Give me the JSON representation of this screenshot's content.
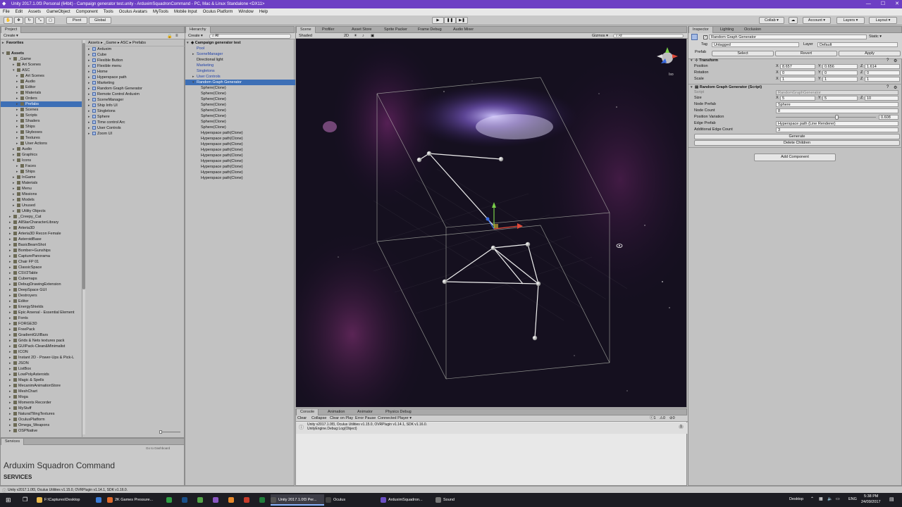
{
  "window": {
    "title": "Unity 2017.1.0f3 Personal (64bit) - Campaign generator test.unity - ArduximSquadronCommand - PC, Mac & Linux Standalone <DX11>"
  },
  "menu": [
    "File",
    "Edit",
    "Assets",
    "GameObject",
    "Component",
    "Tools",
    "Oculus Avatars",
    "MyTools",
    "Mobile Input",
    "Oculus Platform",
    "Window",
    "Help"
  ],
  "toolbar": {
    "pivot": "Pivot",
    "global": "Global",
    "collab": "Collab ▾",
    "account": "Account ▾",
    "layers": "Layers ▾",
    "layout": "Layout ▾"
  },
  "project": {
    "tab": "Project",
    "create": "Create ▾",
    "favorites": "Favorites",
    "assets_root": "Assets",
    "breadcrumb": "Assets ▸ _Game ▸ ASC ▸ Prefabs",
    "tree": [
      {
        "label": "_Game",
        "indent": 2,
        "open": true
      },
      {
        "label": "Art Scenes",
        "indent": 3
      },
      {
        "label": "ASC",
        "indent": 3,
        "open": true
      },
      {
        "label": "Art Scenes",
        "indent": 4
      },
      {
        "label": "Audio",
        "indent": 4
      },
      {
        "label": "Editor",
        "indent": 4
      },
      {
        "label": "Materials",
        "indent": 4
      },
      {
        "label": "Orders",
        "indent": 4
      },
      {
        "label": "Prefabs",
        "indent": 4,
        "selected": true
      },
      {
        "label": "Scenes",
        "indent": 4
      },
      {
        "label": "Scripts",
        "indent": 4
      },
      {
        "label": "Shaders",
        "indent": 4
      },
      {
        "label": "Ships",
        "indent": 4
      },
      {
        "label": "Skyboxes",
        "indent": 4
      },
      {
        "label": "Textures",
        "indent": 4
      },
      {
        "label": "User Actions",
        "indent": 4
      },
      {
        "label": "Audio",
        "indent": 3
      },
      {
        "label": "Graphics",
        "indent": 3
      },
      {
        "label": "Icons",
        "indent": 3,
        "open": true
      },
      {
        "label": "Faces",
        "indent": 4
      },
      {
        "label": "Ships",
        "indent": 4
      },
      {
        "label": "InGame",
        "indent": 3
      },
      {
        "label": "Materials",
        "indent": 3
      },
      {
        "label": "Menu",
        "indent": 3
      },
      {
        "label": "Missions",
        "indent": 3
      },
      {
        "label": "Models",
        "indent": 3
      },
      {
        "label": "Unused",
        "indent": 3
      },
      {
        "label": "Utility Objects",
        "indent": 3
      },
      {
        "label": "_Creepy_Cat",
        "indent": 2
      },
      {
        "label": "AllStarCharacterLibrary",
        "indent": 2
      },
      {
        "label": "Arteria3D",
        "indent": 2
      },
      {
        "label": "Arteria3D Recon Female",
        "indent": 2
      },
      {
        "label": "AsteroidBase",
        "indent": 2
      },
      {
        "label": "BasicBeamShot",
        "indent": 2
      },
      {
        "label": "Bomber+Gunships",
        "indent": 2
      },
      {
        "label": "CapturePanorama",
        "indent": 2
      },
      {
        "label": "Chair FP 01",
        "indent": 2
      },
      {
        "label": "ClassicSpace",
        "indent": 2
      },
      {
        "label": "CSV2Table",
        "indent": 2
      },
      {
        "label": "Cubemaps",
        "indent": 2
      },
      {
        "label": "DebugDrawingExtension",
        "indent": 2
      },
      {
        "label": "DeepSpace GUI",
        "indent": 2
      },
      {
        "label": "Destroyers",
        "indent": 2
      },
      {
        "label": "Editor",
        "indent": 2
      },
      {
        "label": "EnergyShields",
        "indent": 2
      },
      {
        "label": "Epic Arsenal - Essential Element",
        "indent": 2
      },
      {
        "label": "Fonts",
        "indent": 2
      },
      {
        "label": "FORGE3D",
        "indent": 2
      },
      {
        "label": "FreePack",
        "indent": 2
      },
      {
        "label": "GradientGUIBars",
        "indent": 2
      },
      {
        "label": "Grids & Nets textures pack",
        "indent": 2
      },
      {
        "label": "GUIPack-Clean&Minimalist",
        "indent": 2
      },
      {
        "label": "ICON",
        "indent": 2
      },
      {
        "label": "Instant 2D - Power-Ups & Pick-L",
        "indent": 2
      },
      {
        "label": "JSON",
        "indent": 2
      },
      {
        "label": "ListBox",
        "indent": 2
      },
      {
        "label": "LowPolyAsteroids",
        "indent": 2
      },
      {
        "label": "Magic & Spells",
        "indent": 2
      },
      {
        "label": "MecanimAnimationStore",
        "indent": 2
      },
      {
        "label": "MeshChart",
        "indent": 2
      },
      {
        "label": "Moga",
        "indent": 2
      },
      {
        "label": "Moments Recorder",
        "indent": 2
      },
      {
        "label": "MyStuff",
        "indent": 2
      },
      {
        "label": "NaturalTilingTextures",
        "indent": 2
      },
      {
        "label": "OculusPlatform",
        "indent": 2
      },
      {
        "label": "Omega_Weapons",
        "indent": 2
      },
      {
        "label": "OSPNative",
        "indent": 2
      }
    ],
    "files": [
      "Arduxim",
      "Cube",
      "Flexible Button",
      "Flexible menu",
      "Home",
      "Hyperspace path",
      "Marketing",
      "Random Graph Generator",
      "Remote Control Arduxim",
      "SceneManager",
      "Ship Info UI",
      "Singletons",
      "Sphere",
      "Time control Arc",
      "User Controls",
      "Zoom UI"
    ],
    "services_tab": "Services",
    "go_dashboard": "Go to Dashboard",
    "services_title": "Arduxim Squadron Command",
    "services_heading": "SERVICES"
  },
  "hierarchy": {
    "tab": "Hierarchy",
    "create": "Create ▾",
    "search": "All",
    "scene": "Campaign generator test",
    "items": [
      {
        "label": "Pool",
        "blue": true
      },
      {
        "label": "SceneManager",
        "blue": true,
        "arrow": true
      },
      {
        "label": "Directional light"
      },
      {
        "label": "Marketing",
        "blue": true
      },
      {
        "label": "Singletons",
        "blue": true
      },
      {
        "label": "User Controls",
        "blue": true,
        "arrow": true
      },
      {
        "label": "Random Graph Generator",
        "selected": true,
        "arrow": true
      },
      {
        "label": "Sphere(Clone)",
        "child": true
      },
      {
        "label": "Sphere(Clone)",
        "child": true
      },
      {
        "label": "Sphere(Clone)",
        "child": true
      },
      {
        "label": "Sphere(Clone)",
        "child": true
      },
      {
        "label": "Sphere(Clone)",
        "child": true
      },
      {
        "label": "Sphere(Clone)",
        "child": true
      },
      {
        "label": "Sphere(Clone)",
        "child": true
      },
      {
        "label": "Sphere(Clone)",
        "child": true
      },
      {
        "label": "Hyperspace path(Clone)",
        "child": true
      },
      {
        "label": "Hyperspace path(Clone)",
        "child": true
      },
      {
        "label": "Hyperspace path(Clone)",
        "child": true
      },
      {
        "label": "Hyperspace path(Clone)",
        "child": true
      },
      {
        "label": "Hyperspace path(Clone)",
        "child": true
      },
      {
        "label": "Hyperspace path(Clone)",
        "child": true
      },
      {
        "label": "Hyperspace path(Clone)",
        "child": true
      },
      {
        "label": "Hyperspace path(Clone)",
        "child": true
      },
      {
        "label": "Hyperspace path(Clone)",
        "child": true
      }
    ]
  },
  "scene": {
    "tabs": [
      "Scene",
      "Profiler",
      "Asset Store",
      "Sprite Packer",
      "Frame Debug",
      "Audio Mixer"
    ],
    "shading": "Shaded",
    "mode2d": "2D",
    "gizmos": "Gizmos ▾",
    "search": "All",
    "persp": "Iso"
  },
  "console": {
    "tabs": [
      "Console",
      "Animation",
      "Animator",
      "Physics Debug"
    ],
    "buttons": [
      "Clear",
      "Collapse",
      "Clear on Play",
      "Error Pause",
      "Connected Player ▾"
    ],
    "counts": [
      "1",
      "0",
      "0"
    ],
    "line1": "Unity v2017.1.0f3, Oculus Utilities v1.15.0, OVRPlugin v1.14.1, SDK v1.16.0.",
    "line2": "UnityEngine.Debug:Log(Object)",
    "count_badge": "1",
    "status": "Unity v2017.1.0f3, Oculus Utilities v1.15.0, OVRPlugin v1.14.1, SDK v1.16.0."
  },
  "inspector": {
    "tabs": [
      "Inspector",
      "Lighting",
      "Occlusion"
    ],
    "object_name": "Random Graph Generator",
    "static": "Static ▾",
    "tag_label": "Tag",
    "tag": "Untagged",
    "layer_label": "Layer",
    "layer": "Default",
    "prefab_label": "Prefab",
    "prefab_buttons": [
      "Select",
      "Revert",
      "Apply"
    ],
    "transform": {
      "title": "Transform",
      "rows": [
        {
          "label": "Position",
          "x": "8.657",
          "y": "0.656",
          "z": "1.614"
        },
        {
          "label": "Rotation",
          "x": "0",
          "y": "0",
          "z": "0"
        },
        {
          "label": "Scale",
          "x": "1",
          "y": "1",
          "z": "1"
        }
      ]
    },
    "script": {
      "title": "Random Graph Generator (Script)",
      "script_label": "Script",
      "script_value": "RandomGraphGenerator",
      "size_label": "Size",
      "size_x": "5",
      "size_y": "5",
      "size_z": "10",
      "node_prefab_label": "Node Prefab",
      "node_prefab": "Sphere",
      "node_count_label": "Node Count",
      "node_count": "8",
      "pos_var_label": "Position Variation",
      "pos_var": "0.608",
      "edge_prefab_label": "Edge Prefab",
      "edge_prefab": "Hyperspace path (Line Renderer)",
      "add_edge_label": "Additional Edge Count",
      "add_edge": "3",
      "generate": "Generate",
      "delete_children": "Delete Children"
    },
    "add_component": "Add Component"
  },
  "taskbar": {
    "items": [
      {
        "label": "F:\\Captures\\Desktop",
        "color": "#e8b84a"
      },
      {
        "label": "",
        "color": "#3a7bd5"
      },
      {
        "label": "2K Games Pressure...",
        "color": "#e06a2c"
      },
      {
        "label": "",
        "color": "#2f9e44"
      },
      {
        "label": "",
        "color": "#1a4f8a"
      },
      {
        "label": "",
        "color": "#53a548"
      },
      {
        "label": "",
        "color": "#8a56c2"
      },
      {
        "label": "",
        "color": "#e88a2c"
      },
      {
        "label": "",
        "color": "#c63b2b"
      },
      {
        "label": "",
        "color": "#1f7d3a"
      },
      {
        "label": "Unity 2017.1.0f3 Per...",
        "color": "#555555",
        "active": true
      },
      {
        "label": "Oculus",
        "color": "#444444"
      },
      {
        "label": "ArduximSquadron...",
        "color": "#6b4fc4"
      },
      {
        "label": "Sound",
        "color": "#777777"
      }
    ],
    "desktop": "Desktop",
    "lang": "ENG",
    "time": "5:38 PM",
    "date": "24/09/2017"
  },
  "colors": {
    "titlebar": "#6d3fc4",
    "selection": "#3d6fb6",
    "taskbar": "#1d1d23"
  }
}
